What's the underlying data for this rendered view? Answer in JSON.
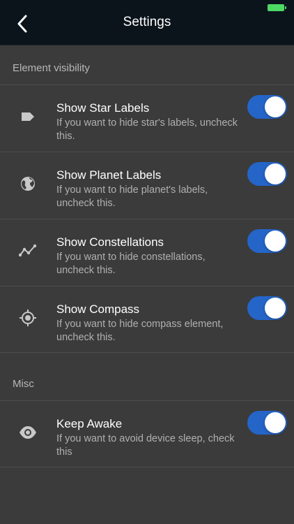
{
  "header": {
    "title": "Settings",
    "back_icon": "chevron-left-icon"
  },
  "status_bar": {
    "battery_color": "#4cd964"
  },
  "sections": [
    {
      "title": "Element visibility",
      "items": [
        {
          "icon": "tag-icon",
          "title": "Show Star Labels",
          "subtitle": "If you want to hide star's labels, uncheck this.",
          "enabled": true
        },
        {
          "icon": "globe-icon",
          "title": "Show Planet Labels",
          "subtitle": "If you want to hide planet's labels, uncheck this.",
          "enabled": true
        },
        {
          "icon": "constellation-icon",
          "title": "Show Constellations",
          "subtitle": "If you want to hide constellations, uncheck this.",
          "enabled": true
        },
        {
          "icon": "target-icon",
          "title": "Show Compass",
          "subtitle": "If you want to hide compass element, uncheck this.",
          "enabled": true
        }
      ]
    },
    {
      "title": "Misc",
      "items": [
        {
          "icon": "eye-icon",
          "title": "Keep Awake",
          "subtitle": "If you want to avoid device sleep, check this",
          "enabled": true
        }
      ]
    }
  ],
  "colors": {
    "background": "#3b3b3b",
    "navbar": "#0b141b",
    "toggle_on": "#2565c8",
    "secondary_text": "#b0b0b0"
  }
}
